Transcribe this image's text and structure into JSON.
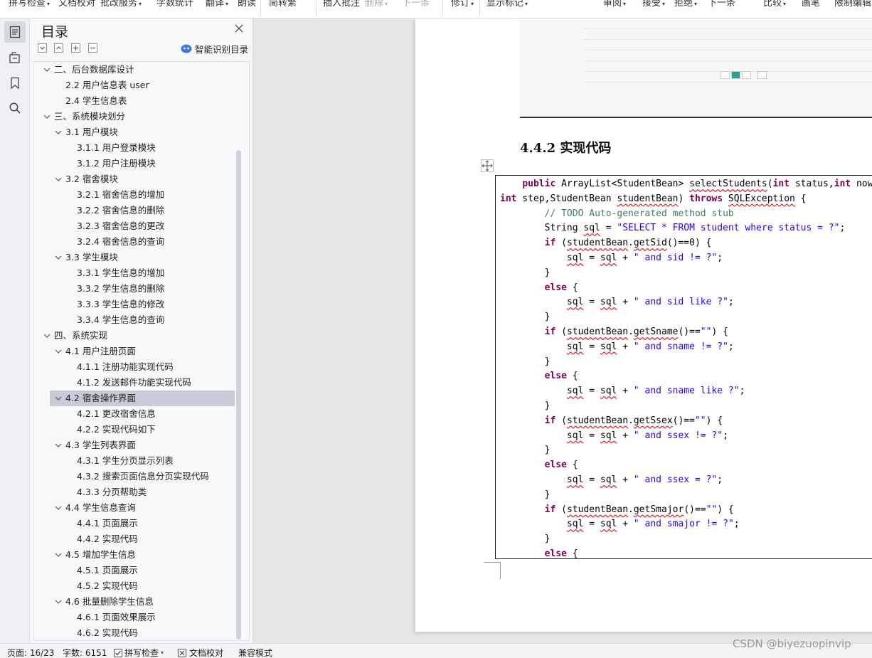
{
  "toolbar": {
    "items": [
      {
        "label": "拼写检查",
        "caret": true
      },
      {
        "label": "文档校对"
      },
      {
        "label": "批改服务",
        "caret": true
      },
      {
        "label": "字数统计"
      },
      {
        "label": "翻译",
        "caret": true
      },
      {
        "label": "朗读"
      },
      {
        "label": "简转繁"
      },
      {
        "label": "插入批注"
      },
      {
        "label": "删除",
        "caret": true,
        "disabled": true
      },
      {
        "label": "下一条",
        "disabled": true
      },
      {
        "label": "修订",
        "caret": true
      },
      {
        "label": "显示标记",
        "caret": true
      },
      {
        "label": "审阅",
        "caret": true
      },
      {
        "label": "接受",
        "caret": true
      },
      {
        "label": "拒绝",
        "caret": true
      },
      {
        "label": "下一条"
      },
      {
        "label": "比较",
        "caret": true
      },
      {
        "label": "画笔"
      },
      {
        "label": "限制编辑"
      }
    ]
  },
  "rail": {
    "icons": [
      "toc-icon",
      "navigation-icon",
      "bookmark-icon",
      "search-icon"
    ]
  },
  "toc": {
    "title": "目录",
    "smart_label": "智能识别目录",
    "items": [
      {
        "text": "二、后台数据库设计",
        "level": 0,
        "expanded": true
      },
      {
        "text": "2.2  用户信息表 user",
        "level": 1
      },
      {
        "text": "2.4 学生信息表",
        "level": 1
      },
      {
        "text": "三、系统模块划分",
        "level": 0,
        "expanded": true
      },
      {
        "text": "3.1  用户模块",
        "level": 1,
        "expanded": true
      },
      {
        "text": "3.1.1  用户登录模块",
        "level": 2
      },
      {
        "text": "3.1.2 用户注册模块",
        "level": 2
      },
      {
        "text": "3.2  宿舍模块",
        "level": 1,
        "expanded": true
      },
      {
        "text": "3.2.1  宿舍信息的增加",
        "level": 2
      },
      {
        "text": "3.2.2  宿舍信息的删除",
        "level": 2
      },
      {
        "text": "3.2.3  宿舍信息的更改",
        "level": 2
      },
      {
        "text": "3.2.4  宿舍信息的查询",
        "level": 2
      },
      {
        "text": "3.3  学生模块",
        "level": 1,
        "expanded": true
      },
      {
        "text": "3.3.1 学生信息的增加",
        "level": 2
      },
      {
        "text": "3.3.2 学生信息的删除",
        "level": 2
      },
      {
        "text": "3.3.3 学生信息的修改",
        "level": 2
      },
      {
        "text": "3.3.4 学生信息的查询",
        "level": 2
      },
      {
        "text": "四、系统实现",
        "level": 0,
        "expanded": true
      },
      {
        "text": "4.1 用户注册页面",
        "level": 1,
        "expanded": true
      },
      {
        "text": "4.1.1 注册功能实现代码",
        "level": 2
      },
      {
        "text": "4.1.2 发送邮件功能实现代码",
        "level": 2
      },
      {
        "text": "4.2 宿舍操作界面",
        "level": 1,
        "expanded": true,
        "selected": true
      },
      {
        "text": "4.2.1 更改宿舍信息",
        "level": 2
      },
      {
        "text": "4.2.2 实现代码如下",
        "level": 2
      },
      {
        "text": "4.3 学生列表界面",
        "level": 1,
        "expanded": true
      },
      {
        "text": "4.3.1  学生分页显示列表",
        "level": 2
      },
      {
        "text": "4.3.2 搜索页面信息分页实现代码",
        "level": 2
      },
      {
        "text": "4.3.3 分页帮助类",
        "level": 2
      },
      {
        "text": "4.4 学生信息查询",
        "level": 1,
        "expanded": true
      },
      {
        "text": "4.4.1 页面展示",
        "level": 2
      },
      {
        "text": "4.4.2 实现代码",
        "level": 2
      },
      {
        "text": "4.5 增加学生信息",
        "level": 1,
        "expanded": true
      },
      {
        "text": "4.5.1  页面展示",
        "level": 2
      },
      {
        "text": "4.5.2 实现代码",
        "level": 2
      },
      {
        "text": "4.6  批量删除学生信息",
        "level": 1,
        "expanded": true
      },
      {
        "text": "4.6.1 页面效果展示",
        "level": 2
      },
      {
        "text": "4.6.2  实现代码",
        "level": 2
      }
    ]
  },
  "doc": {
    "heading": "4.4.2 实现代码",
    "code": [
      [
        [
          "    ",
          ""
        ],
        [
          "public",
          "kw"
        ],
        [
          " ArrayList<StudentBean> ",
          ""
        ],
        [
          "selectStudents",
          "sq"
        ],
        [
          "(",
          ""
        ],
        [
          "int",
          "kw"
        ],
        [
          " status,",
          ""
        ],
        [
          "int",
          "kw"
        ],
        [
          " nowPage,",
          ""
        ]
      ],
      [
        [
          "int",
          "kw"
        ],
        [
          " step,StudentBean ",
          ""
        ],
        [
          "studentBean",
          "sq"
        ],
        [
          ") ",
          ""
        ],
        [
          "throws",
          "kw"
        ],
        [
          " ",
          ""
        ],
        [
          "SQLException",
          "sq"
        ],
        [
          " {",
          ""
        ]
      ],
      [
        [
          "        ",
          ""
        ],
        [
          "// TODO Auto-generated method stub",
          "cm"
        ]
      ],
      [
        [
          "        String ",
          ""
        ],
        [
          "sql",
          "sq"
        ],
        [
          " = ",
          ""
        ],
        [
          "\"SELECT * FROM student where status = ?\"",
          "st"
        ],
        [
          ";",
          ""
        ]
      ],
      [
        [
          "        ",
          ""
        ],
        [
          "if",
          "kw"
        ],
        [
          " (",
          ""
        ],
        [
          "studentBean",
          "sq"
        ],
        [
          ".",
          ""
        ],
        [
          "getSid",
          "sq"
        ],
        [
          "()==0) {",
          ""
        ]
      ],
      [
        [
          "            ",
          ""
        ],
        [
          "sql",
          "sq"
        ],
        [
          " = ",
          ""
        ],
        [
          "sql",
          "sq"
        ],
        [
          " + ",
          ""
        ],
        [
          "\" and sid != ?\"",
          "st"
        ],
        [
          ";",
          ""
        ]
      ],
      [
        [
          "        }",
          ""
        ]
      ],
      [
        [
          "        ",
          ""
        ],
        [
          "else",
          "kw"
        ],
        [
          " {",
          ""
        ]
      ],
      [
        [
          "            ",
          ""
        ],
        [
          "sql",
          "sq"
        ],
        [
          " = ",
          ""
        ],
        [
          "sql",
          "sq"
        ],
        [
          " + ",
          ""
        ],
        [
          "\" and sid like ?\"",
          "st"
        ],
        [
          ";",
          ""
        ]
      ],
      [
        [
          "        }",
          ""
        ]
      ],
      [
        [
          "        ",
          ""
        ],
        [
          "if",
          "kw"
        ],
        [
          " (",
          ""
        ],
        [
          "studentBean",
          "sq"
        ],
        [
          ".",
          ""
        ],
        [
          "getSname",
          "sq"
        ],
        [
          "()==",
          ""
        ],
        [
          "\"\"",
          "st"
        ],
        [
          ") {",
          ""
        ]
      ],
      [
        [
          "            ",
          ""
        ],
        [
          "sql",
          "sq"
        ],
        [
          " = ",
          ""
        ],
        [
          "sql",
          "sq"
        ],
        [
          " + ",
          ""
        ],
        [
          "\" and sname != ?\"",
          "st"
        ],
        [
          ";",
          ""
        ]
      ],
      [
        [
          "        }",
          ""
        ]
      ],
      [
        [
          "        ",
          ""
        ],
        [
          "else",
          "kw"
        ],
        [
          " {",
          ""
        ]
      ],
      [
        [
          "            ",
          ""
        ],
        [
          "sql",
          "sq"
        ],
        [
          " = ",
          ""
        ],
        [
          "sql",
          "sq"
        ],
        [
          " + ",
          ""
        ],
        [
          "\" and sname like ?\"",
          "st"
        ],
        [
          ";",
          ""
        ]
      ],
      [
        [
          "        }",
          ""
        ]
      ],
      [
        [
          "        ",
          ""
        ],
        [
          "if",
          "kw"
        ],
        [
          " (",
          ""
        ],
        [
          "studentBean",
          "sq"
        ],
        [
          ".",
          ""
        ],
        [
          "getSsex",
          "sq"
        ],
        [
          "()==",
          ""
        ],
        [
          "\"\"",
          "st"
        ],
        [
          ") {",
          ""
        ]
      ],
      [
        [
          "            ",
          ""
        ],
        [
          "sql",
          "sq"
        ],
        [
          " = ",
          ""
        ],
        [
          "sql",
          "sq"
        ],
        [
          " + ",
          ""
        ],
        [
          "\" and ssex != ?\"",
          "st"
        ],
        [
          ";",
          ""
        ]
      ],
      [
        [
          "        }",
          ""
        ]
      ],
      [
        [
          "        ",
          ""
        ],
        [
          "else",
          "kw"
        ],
        [
          " {",
          ""
        ]
      ],
      [
        [
          "            ",
          ""
        ],
        [
          "sql",
          "sq"
        ],
        [
          " = ",
          ""
        ],
        [
          "sql",
          "sq"
        ],
        [
          " + ",
          ""
        ],
        [
          "\" and ssex = ?\"",
          "st"
        ],
        [
          ";",
          ""
        ]
      ],
      [
        [
          "        }",
          ""
        ]
      ],
      [
        [
          "        ",
          ""
        ],
        [
          "if",
          "kw"
        ],
        [
          " (",
          ""
        ],
        [
          "studentBean",
          "sq"
        ],
        [
          ".",
          ""
        ],
        [
          "getSmajor",
          "sq"
        ],
        [
          "()==",
          ""
        ],
        [
          "\"\"",
          "st"
        ],
        [
          ") {",
          ""
        ]
      ],
      [
        [
          "            ",
          ""
        ],
        [
          "sql",
          "sq"
        ],
        [
          " = ",
          ""
        ],
        [
          "sql",
          "sq"
        ],
        [
          " + ",
          ""
        ],
        [
          "\" and smajor != ?\"",
          "st"
        ],
        [
          ";",
          ""
        ]
      ],
      [
        [
          "        }",
          ""
        ]
      ],
      [
        [
          "        ",
          ""
        ],
        [
          "else",
          "kw"
        ],
        [
          " {",
          ""
        ]
      ]
    ]
  },
  "status": {
    "page": "页面: 16/23",
    "words": "字数: 6151",
    "spell": "拼写检查",
    "proof": "文档校对",
    "compat": "兼容模式"
  },
  "watermark": "CSDN @biyezuopinvip",
  "colors": {
    "keyword": "#7f0055",
    "string": "#2a00ff",
    "comment": "#3f7f5f",
    "selection": "#c5ccd6",
    "smart_icon": "#3a7be0"
  }
}
